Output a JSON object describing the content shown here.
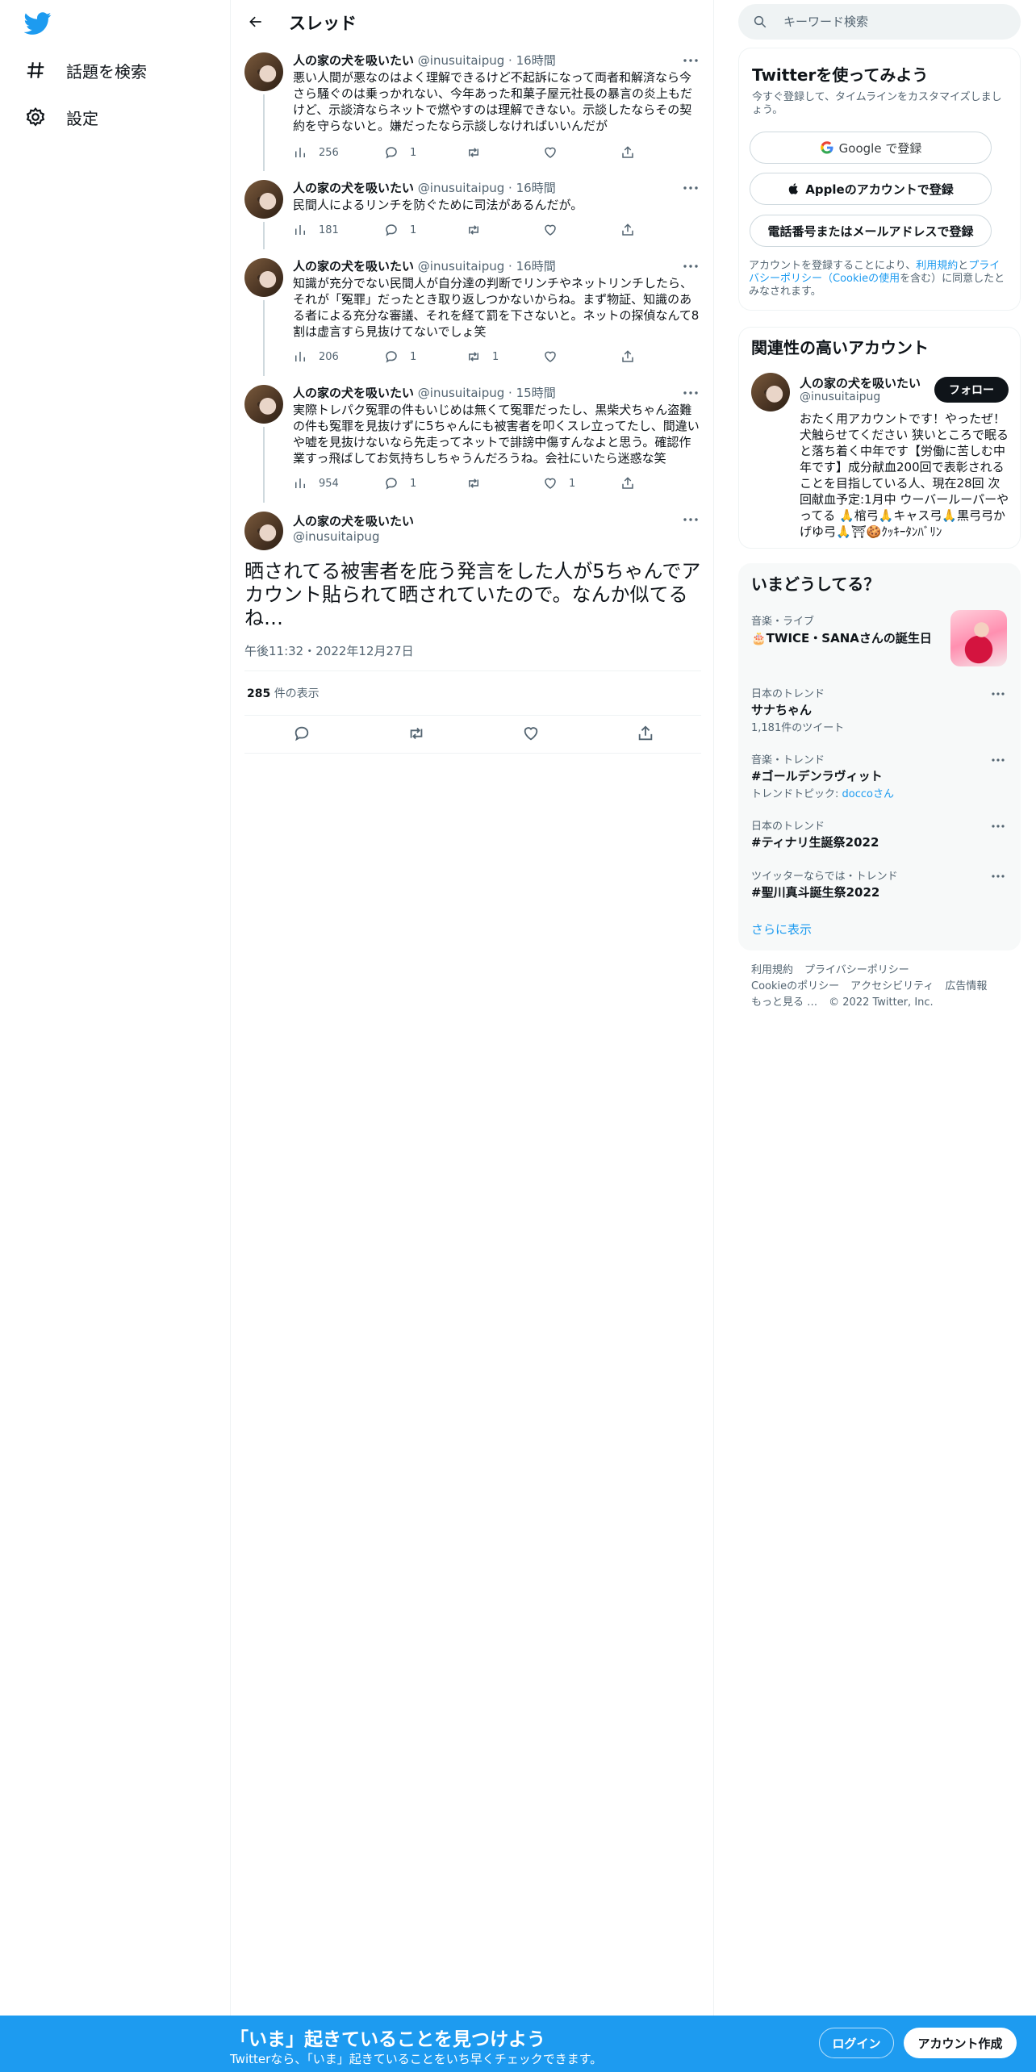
{
  "nav": {
    "logo": "twitter-bird-icon",
    "items": [
      {
        "label": "話題を検索",
        "icon": "hashtag-icon"
      },
      {
        "label": "設定",
        "icon": "gear-icon"
      }
    ]
  },
  "header": {
    "title": "スレッド"
  },
  "thread": [
    {
      "name": "人の家の犬を吸いたい",
      "handle": "@inusuitaipug",
      "time": "16時間",
      "text": "悪い人間が悪なのはよく理解できるけど不起訴になって両者和解済なら今さら騒ぐのは乗っかれない、今年あった和菓子屋元社長の暴言の炎上もだけど、示談済ならネットで燃やすのは理解できない。示談したならその契約を守らないと。嫌だったなら示談しなければいいんだが",
      "views": "256",
      "replies": "1",
      "retweets": "",
      "likes": ""
    },
    {
      "name": "人の家の犬を吸いたい",
      "handle": "@inusuitaipug",
      "time": "16時間",
      "text": "民間人によるリンチを防ぐために司法があるんだが。",
      "views": "181",
      "replies": "1",
      "retweets": "",
      "likes": ""
    },
    {
      "name": "人の家の犬を吸いたい",
      "handle": "@inusuitaipug",
      "time": "16時間",
      "text": "知識が充分でない民間人が自分達の判断でリンチやネットリンチしたら、それが「冤罪」だったとき取り返しつかないからね。まず物証、知識のある者による充分な審議、それを経て罰を下さないと。ネットの探偵なんて8割は虚言すら見抜けてないでしょ笑",
      "views": "206",
      "replies": "1",
      "retweets": "1",
      "likes": ""
    },
    {
      "name": "人の家の犬を吸いたい",
      "handle": "@inusuitaipug",
      "time": "15時間",
      "text": "実際トレパク冤罪の件もいじめは無くて冤罪だったし、黒柴犬ちゃん盗難の件も冤罪を見抜けずに5ちゃんにも被害者を叩くスレ立ってたし、間違いや嘘を見抜けないなら先走ってネットで誹謗中傷すんなよと思う。確認作業すっ飛ばしてお気持ちしちゃうんだろうね。会社にいたら迷惑な笑",
      "views": "954",
      "replies": "1",
      "retweets": "",
      "likes": "1"
    }
  ],
  "main_tweet": {
    "name": "人の家の犬を吸いたい",
    "handle": "@inusuitaipug",
    "text": "晒されてる被害者を庇う発言をした人が5ちゃんでアカウント貼られて晒されていたので。なんか似てるね…",
    "date": "午後11:32・2022年12月27日",
    "views_count": "285",
    "views_label": "件の表示"
  },
  "search": {
    "placeholder": "キーワード検索"
  },
  "signup_card": {
    "title": "Twitterを使ってみよう",
    "subtitle": "今すぐ登録して、タイムラインをカスタマイズしましょう。",
    "google": "Google で登録",
    "apple": "Appleのアカウントで登録",
    "phone": "電話番号またはメールアドレスで登録",
    "legal_prefix": "アカウントを登録することにより、",
    "legal_terms": "利用規約",
    "legal_and": "と",
    "legal_privacy": "プライバシーポリシー（Cookieの使用",
    "legal_suffix": "を含む）に同意したとみなされます。"
  },
  "related": {
    "title": "関連性の高いアカウント",
    "name": "人の家の犬を吸いたい",
    "handle": "@inusuitaipug",
    "follow": "フォロー",
    "bio": "おたく用アカウントです！やったぜ！犬触らせてください 狭いところで眠ると落ち着く中年です【労働に苦しむ中年です】成分献血200回で表彰されることを目指している人、現在28回 次回献血予定:1月中 ウーバールーパーやってる 🙏棺弓🙏キャス弓🙏黒弓弓かげゆ弓🙏⛩🍪ｸｯｷｰﾀﾝﾊﾞﾘﾝ"
  },
  "trends": {
    "title": "いまどうしてる？",
    "items": [
      {
        "meta": "音楽・ライブ",
        "name": "🎂TWICE・SANAさんの誕生日",
        "count": ""
      },
      {
        "meta": "日本のトレンド",
        "name": "サナちゃん",
        "count": "1,181件のツイート"
      },
      {
        "meta": "音楽・トレンド",
        "name": "#ゴールデンラヴィット",
        "count": "トレンドトピック:",
        "topic": "doccoさん"
      },
      {
        "meta": "日本のトレンド",
        "name": "#ティナリ生誕祭2022",
        "count": ""
      },
      {
        "meta": "ツイッターならでは・トレンド",
        "name": "#聖川真斗誕生祭2022",
        "count": ""
      }
    ],
    "show_more": "さらに表示"
  },
  "footer": {
    "links": [
      "利用規約",
      "プライバシーポリシー",
      "Cookieのポリシー",
      "アクセシビリティ",
      "広告情報",
      "もっと見る …"
    ],
    "copyright": "© 2022 Twitter, Inc."
  },
  "banner": {
    "title": "「いま」起きていることを見つけよう",
    "subtitle": "Twitterなら、「いま」起きていることをいち早くチェックできます。",
    "login": "ログイン",
    "signup": "アカウント作成"
  },
  "colors": {
    "accent": "#1d9bf0",
    "text": "#0f1419",
    "muted": "#536471"
  }
}
